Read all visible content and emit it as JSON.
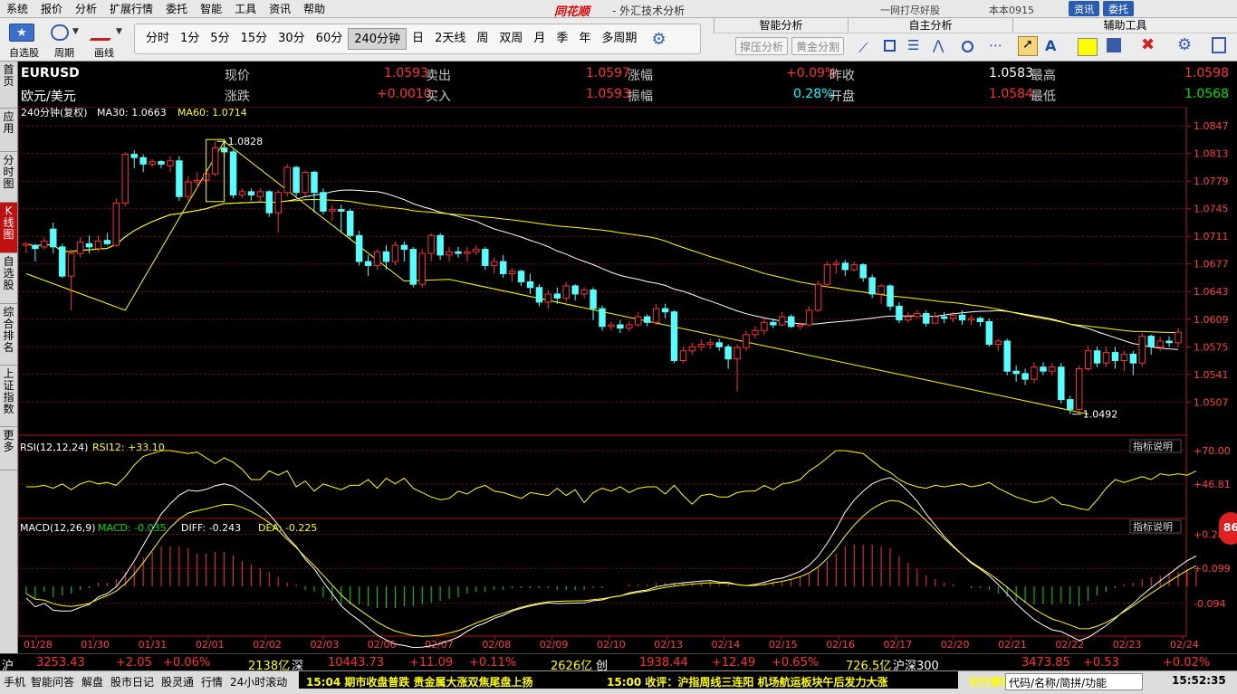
{
  "menu": [
    "系统",
    "报价",
    "分析",
    "扩展行情",
    "委托",
    "智能",
    "工具",
    "资讯",
    "帮助"
  ],
  "app_logo": "同花顺",
  "app_title": "- 外汇技术分析",
  "menu_right": {
    "promo": "一网打尽好股",
    "user": "本本0915",
    "btn1": "资讯",
    "btn2": "委托"
  },
  "toolbar": {
    "self_select": "自选股",
    "period": "周期",
    "draw": "画线",
    "periods": [
      "分时",
      "1分",
      "5分",
      "15分",
      "30分",
      "60分",
      "240分钟",
      "日",
      "2天线",
      "周",
      "双周",
      "月",
      "季",
      "年",
      "多周期"
    ],
    "active_period": "240分钟",
    "smart_analysis": "智能分析",
    "support_pressure": "撑压分析",
    "golden_split": "黄金分割",
    "self_analysis": "自主分析",
    "assist_tools": "辅助工具"
  },
  "left_nav": [
    "首页",
    "应用",
    "分时图",
    "K线图",
    "自选股",
    "综合排名",
    "上证指数",
    "更多"
  ],
  "left_nav_active": "K线图",
  "quote": {
    "symbol": "EURUSD",
    "name": "欧元/美元",
    "rows": [
      [
        {
          "label": "现价",
          "value": "1.0593",
          "color": "red"
        },
        {
          "label": "卖出",
          "value": "1.0597",
          "color": "red"
        },
        {
          "label": "涨幅",
          "value": "+0.09%",
          "color": "red"
        },
        {
          "label": "昨收",
          "value": "1.0583",
          "color": "white"
        },
        {
          "label": "最高",
          "value": "1.0598",
          "color": "red"
        }
      ],
      [
        {
          "label": "涨跌",
          "value": "+0.0010",
          "color": "red"
        },
        {
          "label": "买入",
          "value": "1.0593",
          "color": "red"
        },
        {
          "label": "振幅",
          "value": "0.28%",
          "color": "cyan"
        },
        {
          "label": "开盘",
          "value": "1.0584",
          "color": "red"
        },
        {
          "label": "最低",
          "value": "1.0568",
          "color": "green"
        }
      ]
    ]
  },
  "chart_data": {
    "type": "candlestick",
    "title": "240分钟(复权)",
    "ma_labels": [
      {
        "text": "MA30: 1.0663",
        "color": "#ffffff"
      },
      {
        "text": "MA60: 1.0714",
        "color": "#ffff00"
      }
    ],
    "y_ticks": [
      "1.0847",
      "1.0813",
      "1.0779",
      "1.0745",
      "1.0711",
      "1.0677",
      "1.0643",
      "1.0609",
      "1.0575",
      "1.0541",
      "1.0507"
    ],
    "ylim": [
      1.0475,
      1.0855
    ],
    "x_labels": [
      "01/28",
      "01/30",
      "01/31",
      "02/01",
      "02/02",
      "02/03",
      "02/06",
      "02/07",
      "02/08",
      "02/09",
      "02/10",
      "02/13",
      "02/14",
      "02/15",
      "02/16",
      "02/17",
      "02/20",
      "02/21",
      "02/22",
      "02/23",
      "02/24"
    ],
    "annotations": [
      {
        "text": "1.0828"
      },
      {
        "text": "1.0492"
      }
    ],
    "candles": [
      [
        1.07,
        1.0702,
        1.0704,
        1.069
      ],
      [
        1.07,
        1.0696,
        1.0702,
        1.068
      ],
      [
        1.0698,
        1.0705,
        1.071,
        1.0695
      ],
      [
        1.072,
        1.0698,
        1.0728,
        1.069
      ],
      [
        1.0698,
        1.0662,
        1.0702,
        1.066
      ],
      [
        1.0662,
        1.069,
        1.0695,
        1.062
      ],
      [
        1.069,
        1.0704,
        1.071,
        1.0685
      ],
      [
        1.0702,
        1.0698,
        1.0712,
        1.069
      ],
      [
        1.0696,
        1.0705,
        1.0712,
        1.0692
      ],
      [
        1.0706,
        1.0702,
        1.0715,
        1.07
      ],
      [
        1.07,
        1.0752,
        1.0758,
        1.0698
      ],
      [
        1.0752,
        1.0812,
        1.0815,
        1.0748
      ],
      [
        1.0812,
        1.0808,
        1.0817,
        1.0795
      ],
      [
        1.0808,
        1.08,
        1.0812,
        1.079
      ],
      [
        1.08,
        1.0803,
        1.0806,
        1.0796
      ],
      [
        1.0803,
        1.08,
        1.0805,
        1.0795
      ],
      [
        1.0798,
        1.0804,
        1.081,
        1.079
      ],
      [
        1.0804,
        1.076,
        1.081,
        1.0755
      ],
      [
        1.076,
        1.0778,
        1.0785,
        1.0755
      ],
      [
        1.0778,
        1.078,
        1.079,
        1.077
      ],
      [
        1.078,
        1.0788,
        1.0795,
        1.0772
      ],
      [
        1.0788,
        1.082,
        1.0828,
        1.0785
      ],
      [
        1.082,
        1.0815,
        1.0828,
        1.0808
      ],
      [
        1.0815,
        1.0762,
        1.0818,
        1.0758
      ],
      [
        1.0762,
        1.0766,
        1.077,
        1.0758
      ],
      [
        1.0766,
        1.0762,
        1.077,
        1.0755
      ],
      [
        1.076,
        1.0766,
        1.077,
        1.0752
      ],
      [
        1.0766,
        1.074,
        1.0768,
        1.0735
      ],
      [
        1.074,
        1.0765,
        1.0768,
        1.0716
      ],
      [
        1.0765,
        1.0796,
        1.08,
        1.076
      ],
      [
        1.0796,
        1.0765,
        1.0798,
        1.076
      ],
      [
        1.0765,
        1.079,
        1.0792,
        1.076
      ],
      [
        1.079,
        1.0765,
        1.0792,
        1.074
      ],
      [
        1.0765,
        1.0742,
        1.077,
        1.0738
      ],
      [
        1.0742,
        1.0744,
        1.075,
        1.073
      ],
      [
        1.0744,
        1.0742,
        1.075,
        1.0715
      ],
      [
        1.0742,
        1.0712,
        1.0745,
        1.0708
      ],
      [
        1.0712,
        1.068,
        1.0718,
        1.0675
      ],
      [
        1.068,
        1.0675,
        1.0688,
        1.0662
      ],
      [
        1.0675,
        1.0692,
        1.0695,
        1.067
      ],
      [
        1.0692,
        1.068,
        1.07,
        1.067
      ],
      [
        1.068,
        1.07,
        1.0705,
        1.0675
      ],
      [
        1.07,
        1.0695,
        1.0705,
        1.068
      ],
      [
        1.0695,
        1.0652,
        1.0698,
        1.0648
      ],
      [
        1.0652,
        1.069,
        1.0695,
        1.0648
      ],
      [
        1.069,
        1.0712,
        1.0715,
        1.068
      ],
      [
        1.0712,
        1.0688,
        1.0715,
        1.0682
      ],
      [
        1.0688,
        1.0692,
        1.0698,
        1.068
      ],
      [
        1.0692,
        1.069,
        1.0698,
        1.0685
      ],
      [
        1.069,
        1.0692,
        1.0698,
        1.068
      ],
      [
        1.0692,
        1.0695,
        1.07,
        1.0688
      ],
      [
        1.0695,
        1.0675,
        1.0698,
        1.067
      ],
      [
        1.0675,
        1.068,
        1.0685,
        1.0665
      ],
      [
        1.068,
        1.0665,
        1.0688,
        1.066
      ],
      [
        1.0665,
        1.0668,
        1.0672,
        1.0655
      ],
      [
        1.0668,
        1.0655,
        1.067,
        1.065
      ],
      [
        1.0655,
        1.0648,
        1.0665,
        1.064
      ],
      [
        1.0648,
        1.063,
        1.0652,
        1.0625
      ],
      [
        1.063,
        1.064,
        1.0645,
        1.0622
      ],
      [
        1.064,
        1.0635,
        1.0648,
        1.0628
      ],
      [
        1.0635,
        1.065,
        1.0655,
        1.063
      ],
      [
        1.065,
        1.064,
        1.0652,
        1.0632
      ],
      [
        1.064,
        1.0645,
        1.0648,
        1.0635
      ],
      [
        1.0645,
        1.0622,
        1.0648,
        1.0608
      ],
      [
        1.0622,
        1.06,
        1.0626,
        1.0595
      ],
      [
        1.06,
        1.0602,
        1.0606,
        1.0595
      ],
      [
        1.0602,
        1.0598,
        1.0608,
        1.0592
      ],
      [
        1.0598,
        1.0602,
        1.0606,
        1.0594
      ],
      [
        1.0602,
        1.0612,
        1.0618,
        1.06
      ],
      [
        1.0612,
        1.0605,
        1.0615,
        1.06
      ],
      [
        1.0605,
        1.0622,
        1.0628,
        1.0602
      ],
      [
        1.0622,
        1.0618,
        1.0628,
        1.061
      ],
      [
        1.0618,
        1.0558,
        1.062,
        1.0555
      ],
      [
        1.0558,
        1.057,
        1.0575,
        1.0555
      ],
      [
        1.057,
        1.0575,
        1.058,
        1.0565
      ],
      [
        1.0575,
        1.0578,
        1.0584,
        1.057
      ],
      [
        1.0578,
        1.058,
        1.0585,
        1.0572
      ],
      [
        1.058,
        1.0575,
        1.0585,
        1.057
      ],
      [
        1.0575,
        1.056,
        1.0578,
        1.0548
      ],
      [
        1.056,
        1.0574,
        1.0578,
        1.052
      ],
      [
        1.0574,
        1.059,
        1.0595,
        1.057
      ],
      [
        1.059,
        1.0595,
        1.06,
        1.0585
      ],
      [
        1.0595,
        1.0605,
        1.061,
        1.059
      ],
      [
        1.0605,
        1.0602,
        1.061,
        1.0598
      ],
      [
        1.0602,
        1.0612,
        1.0618,
        1.06
      ],
      [
        1.0612,
        1.06,
        1.0615,
        1.0598
      ],
      [
        1.06,
        1.0602,
        1.0605,
        1.0596
      ],
      [
        1.0602,
        1.062,
        1.0625,
        1.06
      ],
      [
        1.062,
        1.0652,
        1.0656,
        1.0618
      ],
      [
        1.0652,
        1.0676,
        1.068,
        1.0648
      ],
      [
        1.0676,
        1.0678,
        1.0682,
        1.0665
      ],
      [
        1.0678,
        1.067,
        1.0682,
        1.0662
      ],
      [
        1.067,
        1.0676,
        1.068,
        1.0668
      ],
      [
        1.0676,
        1.066,
        1.0678,
        1.0655
      ],
      [
        1.066,
        1.064,
        1.0664,
        1.0635
      ],
      [
        1.064,
        1.065,
        1.0652,
        1.0628
      ],
      [
        1.065,
        1.0625,
        1.0652,
        1.062
      ],
      [
        1.0625,
        1.0608,
        1.063,
        1.0604
      ],
      [
        1.0608,
        1.0612,
        1.0618,
        1.0605
      ],
      [
        1.0612,
        1.0616,
        1.062,
        1.061
      ],
      [
        1.0616,
        1.0604,
        1.062,
        1.06
      ],
      [
        1.0604,
        1.0612,
        1.0618,
        1.0604
      ],
      [
        1.0612,
        1.061,
        1.0618,
        1.0604
      ],
      [
        1.061,
        1.0614,
        1.0618,
        1.0605
      ],
      [
        1.0614,
        1.0608,
        1.062,
        1.0602
      ],
      [
        1.0608,
        1.061,
        1.0614,
        1.0602
      ],
      [
        1.061,
        1.0606,
        1.0612,
        1.06
      ],
      [
        1.0606,
        1.0578,
        1.061,
        1.0575
      ],
      [
        1.0578,
        1.0582,
        1.0585,
        1.057
      ],
      [
        1.0582,
        1.0545,
        1.0585,
        1.054
      ],
      [
        1.0545,
        1.0542,
        1.0552,
        1.0532
      ],
      [
        1.0542,
        1.0535,
        1.0548,
        1.0528
      ],
      [
        1.0535,
        1.055,
        1.0556,
        1.053
      ],
      [
        1.055,
        1.0545,
        1.0556,
        1.054
      ],
      [
        1.0545,
        1.055,
        1.0555,
        1.054
      ],
      [
        1.055,
        1.051,
        1.0555,
        1.0505
      ],
      [
        1.051,
        1.0498,
        1.0515,
        1.0492
      ],
      [
        1.0498,
        1.0548,
        1.0552,
        1.0495
      ],
      [
        1.0548,
        1.057,
        1.0576,
        1.0545
      ],
      [
        1.057,
        1.0555,
        1.0575,
        1.055
      ],
      [
        1.0555,
        1.0568,
        1.0575,
        1.055
      ],
      [
        1.0568,
        1.0558,
        1.0575,
        1.0548
      ],
      [
        1.0558,
        1.0566,
        1.057,
        1.0545
      ],
      [
        1.0566,
        1.0555,
        1.057,
        1.054
      ],
      [
        1.0555,
        1.0588,
        1.0592,
        1.055
      ],
      [
        1.0588,
        1.0575,
        1.059,
        1.0565
      ],
      [
        1.0575,
        1.0582,
        1.0588,
        1.057
      ],
      [
        1.0582,
        1.058,
        1.0588,
        1.0575
      ],
      [
        1.058,
        1.0593,
        1.0598,
        1.0575
      ]
    ],
    "rsi": {
      "label": "RSI(12,12,24)",
      "value_label": "RSI12: +33.10",
      "y_ticks": [
        "+70.00",
        "+46.81"
      ],
      "ylim": [
        25,
        75
      ],
      "values": [
        45,
        45,
        46,
        44,
        47,
        43,
        47,
        49,
        47,
        48,
        46,
        52,
        60,
        66,
        68,
        70,
        70,
        69,
        68,
        69,
        65,
        61,
        65,
        62,
        57,
        50,
        50,
        56,
        53,
        56,
        45,
        49,
        42,
        47,
        45,
        43,
        46,
        46,
        50,
        44,
        51,
        47,
        51,
        44,
        41,
        38,
        36,
        37,
        42,
        40,
        44,
        46,
        42,
        41,
        39,
        37,
        41,
        40,
        39,
        44,
        39,
        43,
        34,
        41,
        44,
        42,
        45,
        41,
        44,
        45,
        45,
        40,
        46,
        39,
        33,
        39,
        40,
        38,
        38,
        41,
        42,
        42,
        46,
        43,
        47,
        48,
        50,
        56,
        60,
        65,
        70,
        70,
        69,
        68,
        63,
        58,
        55,
        50,
        47,
        45,
        44,
        46,
        45,
        46,
        47,
        45,
        46,
        48,
        44,
        41,
        38,
        36,
        34,
        35,
        38,
        33,
        32,
        30,
        29,
        36,
        44,
        50,
        48,
        50,
        52,
        50,
        54,
        53,
        54,
        53,
        56
      ]
    },
    "macd": {
      "label": "MACD(12,26,9)",
      "macd_label": "MACD: -0.035",
      "diff_label": "DIFF: -0.243",
      "dea_label": "DEA: -0.225",
      "y_ticks": [
        "+0.287",
        "+0.099",
        "-0.094"
      ],
      "ylim": [
        -0.26,
        0.3
      ],
      "macd": [
        -0.04,
        -0.07,
        -0.03,
        -0.06,
        -0.05,
        -0.04,
        -0.02,
        -0.01,
        0.02,
        0.02,
        0.04,
        0.08,
        0.12,
        0.16,
        0.19,
        0.22,
        0.22,
        0.22,
        0.21,
        0.18,
        0.18,
        0.19,
        0.19,
        0.17,
        0.14,
        0.12,
        0.1,
        0.08,
        0.05,
        0.02,
        0.01,
        -0.02,
        -0.03,
        -0.06,
        -0.08,
        -0.1,
        -0.1,
        -0.1,
        -0.11,
        -0.12,
        -0.12,
        -0.12,
        -0.11,
        -0.11,
        -0.1,
        -0.09,
        -0.08,
        -0.07,
        -0.06,
        -0.04,
        -0.03,
        -0.03,
        -0.02,
        -0.02,
        -0.01,
        -0.01,
        -0.01,
        -0.01,
        -0.01,
        -0.02,
        -0.02,
        -0.02,
        -0.02,
        -0.01,
        -0.01,
        0,
        0,
        0.01,
        0.01,
        0.01,
        0.02,
        0.02,
        0.02,
        0.02,
        0.02,
        0.02,
        0.02,
        0.01,
        0.01,
        0,
        0,
        0.01,
        0.02,
        0.03,
        0.03,
        0.04,
        0.05,
        0.07,
        0.1,
        0.14,
        0.18,
        0.22,
        0.23,
        0.23,
        0.23,
        0.22,
        0.21,
        0.17,
        0.13,
        0.1,
        0.06,
        0.04,
        0.02,
        0.01,
        0,
        -0.01,
        -0.01,
        -0.02,
        -0.04,
        -0.06,
        -0.08,
        -0.09,
        -0.1,
        -0.1,
        -0.1,
        -0.09,
        -0.1,
        -0.11,
        -0.08,
        -0.05,
        -0.03,
        -0.01,
        0.01,
        0.02,
        0.04,
        0.05,
        0.06,
        0.07,
        0.08,
        0.09,
        0.09
      ]
    }
  },
  "status_top": {
    "sh_label": "沪",
    "sh_val": "3253.43",
    "sh_chg": "+2.05",
    "sh_pct": "+0.06%",
    "sh_amt": "2138亿",
    "sz_label": "深",
    "sz_val": "10443.73",
    "sz_chg": "+11.09",
    "sz_pct": "+0.11%",
    "sz_amt": "2626亿",
    "cy_label": "创",
    "cy_val": "1938.44",
    "cy_chg": "+12.49",
    "cy_pct": "+0.65%",
    "cy_amt": "726.5亿",
    "hs_label": "沪深300",
    "hs_val": "3473.85",
    "hs_chg": "+0.53",
    "hs_pct": "+0.02%"
  },
  "status_bottom": {
    "items": [
      "手机",
      "智能问答",
      "解盘",
      "股市日记",
      "股灵通",
      "行情",
      "24小时滚动"
    ],
    "ticker1": "15:04 期市收盘普跌 贵金属大涨双焦尾盘上扬",
    "ticker2": "15:00 收评：沪指周线三连阳 机场航运板块午后发力大涨",
    "ticker3": "农行掌银，",
    "search_placeholder": "代码/名称/简拼/功能",
    "clock": "15:52:35"
  },
  "badge": "86"
}
